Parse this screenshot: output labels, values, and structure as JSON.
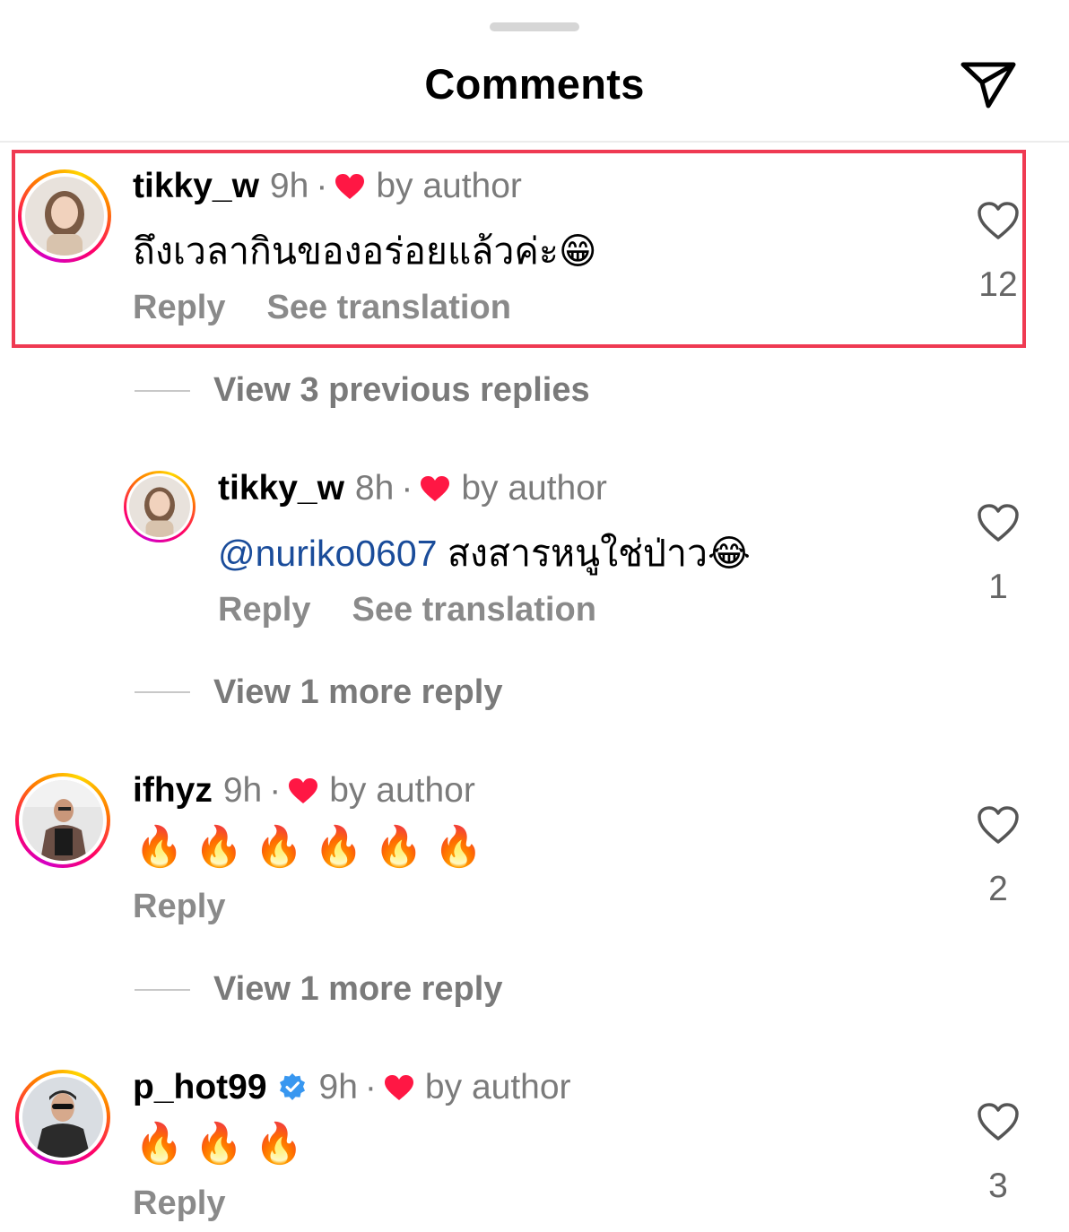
{
  "header": {
    "title": "Comments"
  },
  "comments": [
    {
      "username": "tikky_w",
      "time": "9h",
      "liked_by": "by author",
      "text": "ถึงเวลากินของอร่อยแล้วค่ะ😁",
      "actions": [
        "Reply",
        "See translation"
      ],
      "likes": "12"
    },
    {
      "username": "tikky_w",
      "time": "8h",
      "liked_by": "by author",
      "mention": "@nuriko0607",
      "text": "สงสารหนูใช่ป่าว😂",
      "actions": [
        "Reply",
        "See translation"
      ],
      "likes": "1"
    },
    {
      "username": "ifhyz",
      "time": "9h",
      "liked_by": "by author",
      "text": "🔥🔥🔥🔥🔥🔥",
      "actions": [
        "Reply"
      ],
      "likes": "2"
    },
    {
      "username": "p_hot99",
      "time": "9h",
      "liked_by": "by author",
      "text": "🔥🔥🔥",
      "actions": [
        "Reply"
      ],
      "likes": "3"
    }
  ],
  "view_replies": [
    "View 3 previous replies",
    "View 1 more reply",
    "View 1 more reply"
  ],
  "colors": {
    "highlight": "#ef3a52",
    "heart": "#ff1744",
    "verified": "#3897f0",
    "mention": "#1a4c9a"
  },
  "icons": {
    "send": "send-icon",
    "like": "heart-outline-icon",
    "liked": "heart-filled-icon",
    "verified": "verified-badge-icon"
  }
}
